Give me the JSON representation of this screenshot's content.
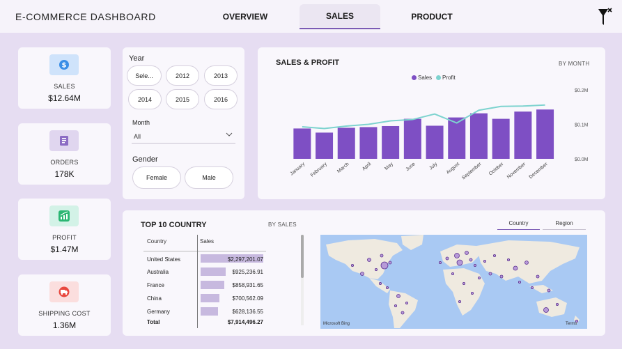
{
  "header": {
    "title": "E-COMMERCE DASHBOARD",
    "tabs": [
      {
        "label": "OVERVIEW",
        "active": false
      },
      {
        "label": "SALES",
        "active": true
      },
      {
        "label": "PRODUCT",
        "active": false
      }
    ]
  },
  "kpis": [
    {
      "label": "SALES",
      "value": "$12.64M",
      "icon": "dollar-coin-icon",
      "icon_bg": "#cfe3fb"
    },
    {
      "label": "ORDERS",
      "value": "178K",
      "icon": "receipt-icon",
      "icon_bg": "#e0d6ef"
    },
    {
      "label": "PROFIT",
      "value": "$1.47M",
      "icon": "growth-chart-icon",
      "icon_bg": "#d3f2e7"
    },
    {
      "label": "SHIPPING COST",
      "value": "1.36M",
      "icon": "delivery-truck-icon",
      "icon_bg": "#fbdede"
    }
  ],
  "filters": {
    "year": {
      "title": "Year",
      "options": [
        "Sele...",
        "2012",
        "2013",
        "2014",
        "2015",
        "2016"
      ]
    },
    "month": {
      "title": "Month",
      "value": "All"
    },
    "gender": {
      "title": "Gender",
      "options": [
        "Female",
        "Male"
      ]
    }
  },
  "sales_profit": {
    "title": "SALES & PROFIT",
    "subtitle": "BY MONTH",
    "legend": [
      "Sales",
      "Profit"
    ],
    "colors": {
      "sales": "#7e4fc4",
      "profit": "#7dd3cf"
    }
  },
  "chart_data": {
    "type": "bar",
    "categories": [
      "January",
      "February",
      "March",
      "April",
      "May",
      "June",
      "July",
      "August",
      "September",
      "October",
      "November",
      "December"
    ],
    "series": [
      {
        "name": "Sales",
        "type": "bar",
        "values": [
          0.088,
          0.076,
          0.09,
          0.092,
          0.095,
          0.116,
          0.096,
          0.12,
          0.132,
          0.116,
          0.137,
          0.143
        ]
      },
      {
        "name": "Profit",
        "type": "line",
        "values": [
          0.093,
          0.088,
          0.095,
          0.1,
          0.11,
          0.114,
          0.13,
          0.104,
          0.141,
          0.152,
          0.153,
          0.156
        ]
      }
    ],
    "yticks": [
      "$0.0M",
      "$0.1M",
      "$0.2M"
    ],
    "ylim": [
      0,
      0.2
    ]
  },
  "top_country": {
    "title": "TOP 10 COUNTRY",
    "subtitle": "BY SALES",
    "columns": [
      "Country",
      "Sales"
    ],
    "rows": [
      {
        "country": "United States",
        "sales": "$2,297,201.07",
        "value": 2297201.07
      },
      {
        "country": "Australia",
        "sales": "$925,236.91",
        "value": 925236.91
      },
      {
        "country": "France",
        "sales": "$858,931.65",
        "value": 858931.65
      },
      {
        "country": "China",
        "sales": "$700,562.09",
        "value": 700562.09
      },
      {
        "country": "Germany",
        "sales": "$628,136.55",
        "value": 628136.55
      }
    ],
    "total_label": "Total",
    "total_value": "$7,914,496.27",
    "toggle": [
      "Country",
      "Region"
    ],
    "map_credit": "Microsoft Bing",
    "map_terms": "Terms"
  }
}
